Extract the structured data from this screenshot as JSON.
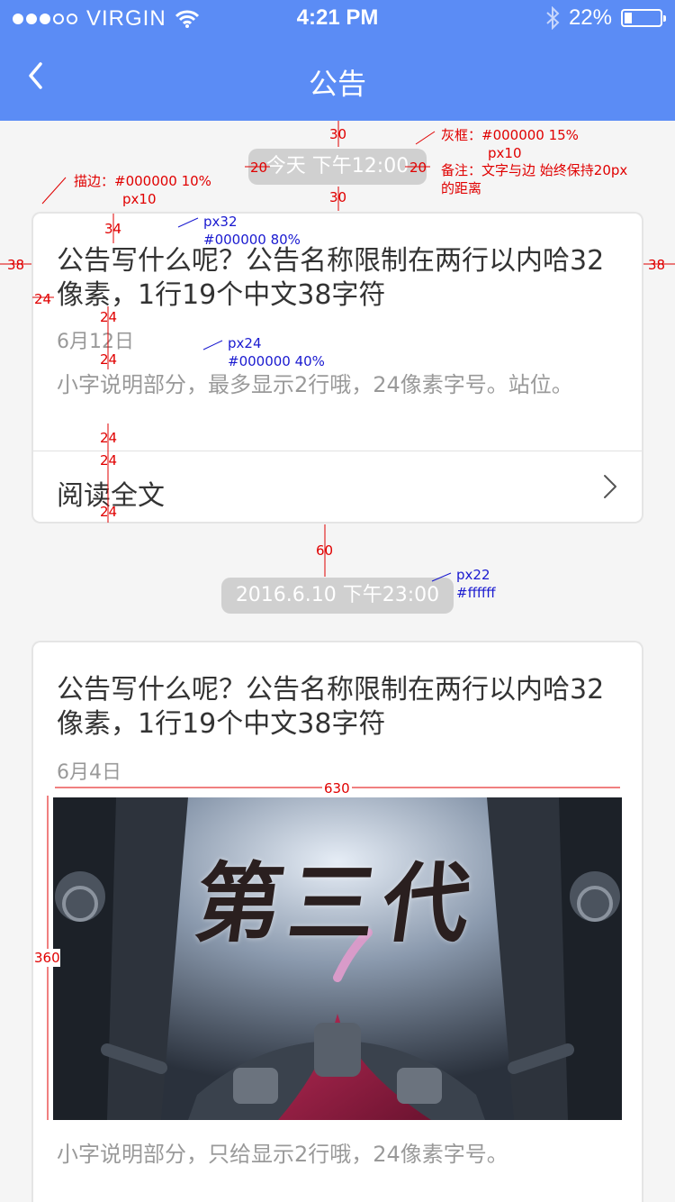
{
  "status_bar": {
    "carrier": "VIRGIN",
    "time": "4:21 PM",
    "battery_percent": "22%",
    "battery_level": 0.22,
    "signal_bars_filled": 3,
    "signal_bars_total": 5
  },
  "nav": {
    "title": "公告",
    "back_icon": "chevron-left-icon"
  },
  "feed": [
    {
      "time_label": "今天 下午12:00",
      "title": "公告写什么呢？公告名称限制在两行以内哈32像素，1行19个中文38字符",
      "date": "6月12日",
      "description": "小字说明部分，最多显示2行哦，24像素字号。站位。",
      "read_more": "阅读全文"
    },
    {
      "time_label": "2016.6.10 下午23:00",
      "title": "公告写什么呢？公告名称限制在两行以内哈32像素，1行19个中文38字符",
      "date": "6月4日",
      "banner_text": "第三代",
      "description": "小字说明部分，只给显示2行哦，24像素字号。"
    }
  ],
  "annotations": {
    "gap_top": "30",
    "gap_pill_side": "20",
    "gap_below_pill": "30",
    "gray_box_note": "灰框：#000000 15%",
    "gray_box_radius": "px10",
    "remark": "备注：文字与边 始终保持20px",
    "remark_2": "的距离",
    "stroke_note": "描边：#000000 10%",
    "stroke_radius": "px10",
    "card_margin": "38",
    "title_top": "34",
    "title_left": "24",
    "title_size": "px32",
    "title_color": "#000000 80%",
    "gap_24": "24",
    "date_size": "px24",
    "date_color": "#000000 40%",
    "gap_between_cards": "60",
    "pill_size": "px22",
    "pill_color": "#ffffff",
    "image_width": "630",
    "image_height": "360"
  },
  "colors": {
    "header_bg": "#5b8cf5",
    "page_bg": "#f5f5f5",
    "annotation_red": "#e00000",
    "annotation_blue": "#1a1ad0"
  }
}
